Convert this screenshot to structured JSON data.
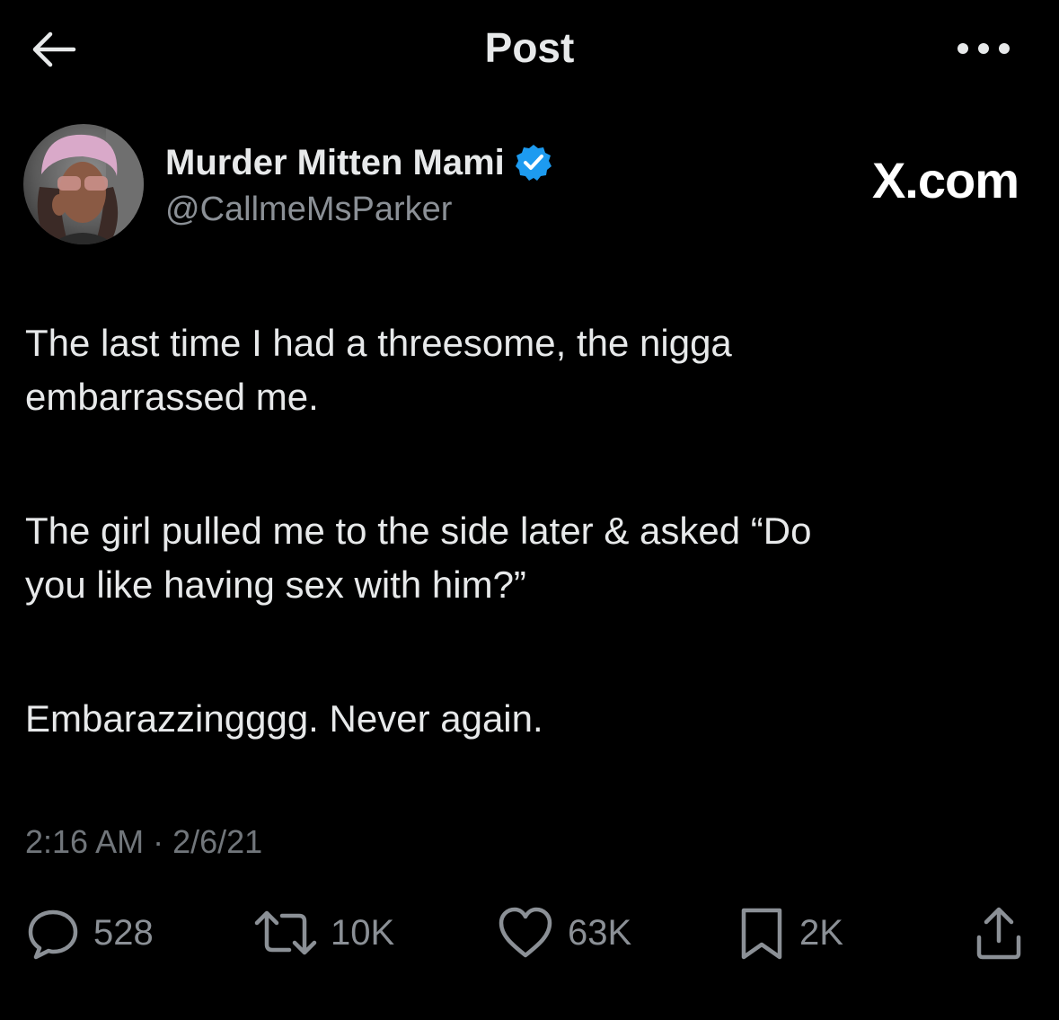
{
  "header": {
    "title": "Post"
  },
  "author": {
    "display_name": "Murder Mitten Mami",
    "handle": "@CallmeMsParker",
    "verified": true
  },
  "watermark": {
    "text": "X.com"
  },
  "tweet": {
    "paragraphs": [
      "The last time I had a threesome, the nigga\nembarrassed me.",
      "The girl pulled me to the side later & asked “Do\nyou like having sex with him?”",
      "Embarazzingggg. Never again."
    ],
    "timestamp": "2:16 AM · 2/6/21"
  },
  "actions": {
    "replies": "528",
    "reposts": "10K",
    "likes": "63K",
    "bookmarks": "2K"
  },
  "colors": {
    "background": "#000000",
    "text": "#e7e9ea",
    "secondary": "#71767b",
    "verified": "#1d9bf0"
  },
  "icons": {
    "back": "arrow-left-icon",
    "more": "more-horizontal-icon",
    "verified": "verified-badge-icon",
    "reply": "reply-icon",
    "repost": "repost-icon",
    "like": "heart-icon",
    "bookmark": "bookmark-icon",
    "share": "share-icon"
  }
}
